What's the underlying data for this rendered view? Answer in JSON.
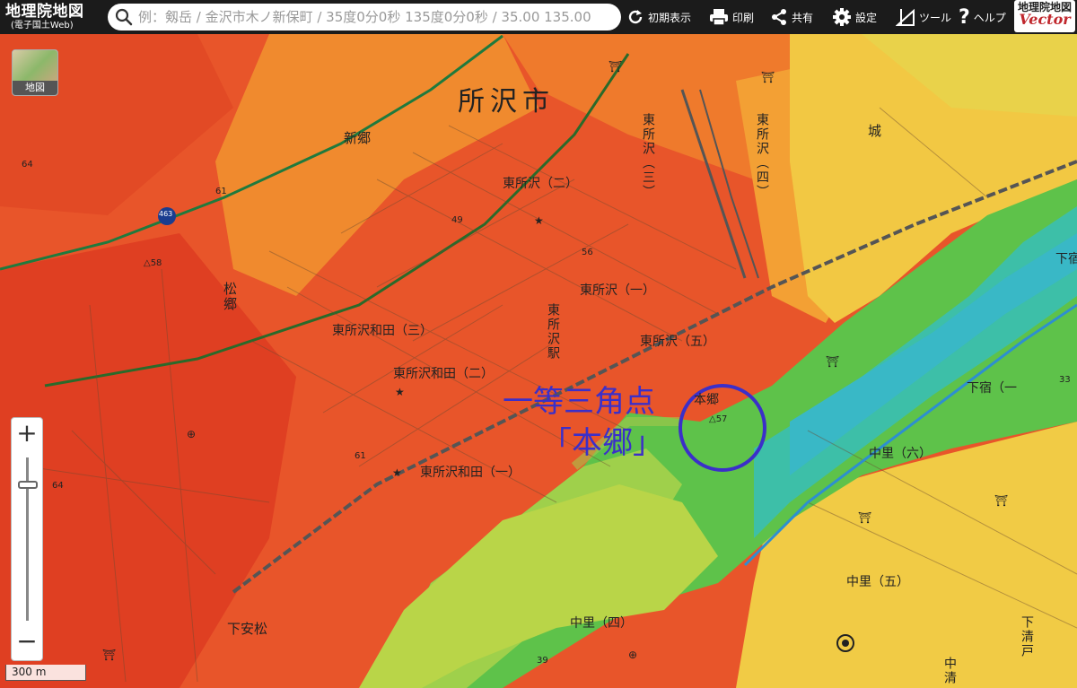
{
  "header": {
    "title": "地理院地図",
    "subtitle": "(電子国土Web)",
    "search_placeholder": "例：剱岳 / 金沢市木ノ新保町 / 35度0分0秒 135度0分0秒 / 35.00 135.00",
    "buttons": {
      "reset": "初期表示",
      "print": "印刷",
      "share": "共有",
      "settings": "設定",
      "tools": "ツール",
      "help": "ヘルプ"
    },
    "vector_logo_top": "地理院地図",
    "vector_logo_bottom": "Vector"
  },
  "map": {
    "layer_button_label": "地図",
    "scale_label": "300 m",
    "zoom_in": "+",
    "zoom_out": "−",
    "annotation_line1": "一等三角点",
    "annotation_line2": "「本郷」",
    "labels": {
      "city": "所沢市",
      "shingo": "新郷",
      "matsugo": "松郷",
      "shimoyasumatsu": "下安松",
      "higashitokorozawa_2": "東所沢（二）",
      "higashitokorozawa_1": "東所沢（一）",
      "higashitokorozawa_5": "東所沢（五）",
      "higashitokorozawa_3_vert": "東所沢（三）",
      "higashitokorozawa_4_vert": "東所沢（四）",
      "station_vert": "東所沢駅",
      "wada_3": "東所沢和田（三）",
      "wada_2": "東所沢和田（二）",
      "wada_1": "東所沢和田（一）",
      "hongo": "本郷",
      "shiro": "城",
      "nakazato_6": "中里（六）",
      "nakazato_5": "中里（五）",
      "nakazato_4": "中里（四）",
      "shimojuku": "下宿（一",
      "shimojuku_right": "下宿",
      "shimokiyoto": "下清戸",
      "nakakiyo": "中清",
      "elev_64a": "64",
      "elev_64b": "64",
      "elev_61a": "61",
      "elev_61b": "61",
      "elev_49": "49",
      "elev_56": "56",
      "elev_58": "△58",
      "elev_57": "△57",
      "elev_39": "39",
      "elev_33": "33",
      "route_463": "463"
    }
  }
}
